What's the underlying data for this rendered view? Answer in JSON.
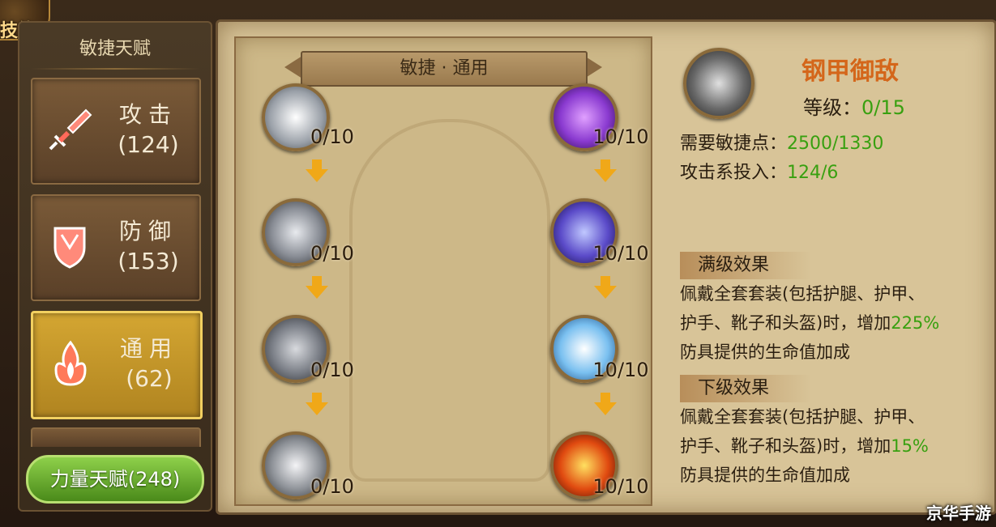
{
  "corner": {
    "label": "技能"
  },
  "sidebar": {
    "title": "敏捷天赋",
    "categories": [
      {
        "name": "攻击",
        "count": "(124)",
        "icon": "sword-icon"
      },
      {
        "name": "防御",
        "count": "(153)",
        "icon": "shield-icon"
      },
      {
        "name": "通用",
        "count": "(62)",
        "icon": "flame-icon",
        "active": true
      }
    ],
    "strength_button": "力量天赋(248)"
  },
  "tree": {
    "banner": "敏捷 · 通用",
    "left_column": [
      {
        "count": "0/10",
        "icon": "light-burst-icon"
      },
      {
        "count": "0/10",
        "icon": "whirlwind-icon"
      },
      {
        "count": "0/10",
        "icon": "chalice-icon"
      },
      {
        "count": "0/10",
        "icon": "chalice-glow-icon"
      }
    ],
    "right_column": [
      {
        "count": "10/10",
        "icon": "purple-orb-icon"
      },
      {
        "count": "10/10",
        "icon": "lightning-claws-icon"
      },
      {
        "count": "10/10",
        "icon": "holy-figure-icon"
      },
      {
        "count": "10/10",
        "icon": "flame-hand-icon"
      }
    ]
  },
  "detail": {
    "skill_name": "钢甲御敌",
    "level_label": "等级：",
    "level_value": "0/15",
    "req_points_label": "需要敏捷点：",
    "req_points_value": "2500/1330",
    "attack_invest_label": "攻击系投入：",
    "attack_invest_value": "124/6",
    "max_head": "满级效果",
    "max_desc_1": "佩戴全套套装(包括护腿、护甲、",
    "max_desc_2a": "护手、靴子和头盔)时，增加",
    "max_desc_2b": "225%",
    "max_desc_3": "防具提供的生命值加成",
    "next_head": "下级效果",
    "next_desc_1": "佩戴全套套装(包括护腿、护甲、",
    "next_desc_2a": "护手、靴子和头盔)时，增加",
    "next_desc_2b": "15%",
    "next_desc_3": "防具提供的生命值加成"
  },
  "watermark": "京华手游",
  "colors": {
    "accent_green": "#38a010",
    "skill_name": "#d4661a",
    "arrow": "#f0a818"
  }
}
